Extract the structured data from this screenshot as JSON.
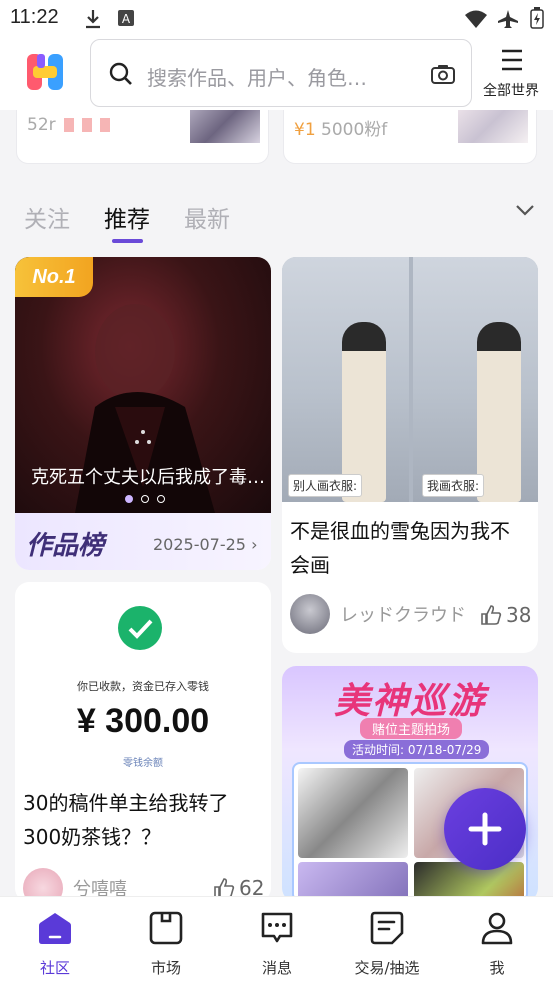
{
  "status_bar": {
    "time": "11:22"
  },
  "header": {
    "search_placeholder": "搜索作品、用户、角色…",
    "menu_label": "全部世界"
  },
  "top_cards": [
    {
      "meta": "52r"
    },
    {
      "price": "¥1",
      "meta": "5000粉f"
    }
  ],
  "tabs": [
    {
      "label": "关注",
      "active": false
    },
    {
      "label": "推荐",
      "active": true
    },
    {
      "label": "最新",
      "active": false
    }
  ],
  "feed": {
    "ranking": {
      "badge": "No.1",
      "caption": "克死五个丈夫以后我成了毒…",
      "title": "作品榜",
      "date": "2025-07-25",
      "carousel_dots": 3,
      "active_dot": 0
    },
    "post1": {
      "tag_left": "别人画衣服:",
      "tag_right": "我画衣服:",
      "title_line1": "不是很血的雪兔因为我不",
      "title_line2": "会画",
      "author": "レッドクラウド",
      "likes": "38"
    },
    "post2": {
      "receipt_line": "你已收款，资金已存入零钱",
      "amount": "¥ 300.00",
      "receipt_sub": "零钱余额",
      "title_line1": "30的稿件单主给我转了",
      "title_line2": "300奶茶钱？？",
      "author": "兮嘻嘻",
      "likes": "62"
    },
    "post3": {
      "event_title": "美神巡游",
      "event_sub": "赌位主题拍场",
      "event_time": "活动时间: 07/18-07/29"
    }
  },
  "fab": {
    "icon": "plus-icon"
  },
  "bottom_nav": [
    {
      "label": "社区",
      "icon": "home-icon",
      "active": true
    },
    {
      "label": "市场",
      "icon": "market-icon",
      "active": false
    },
    {
      "label": "消息",
      "icon": "message-icon",
      "active": false
    },
    {
      "label": "交易/抽选",
      "icon": "trade-icon",
      "active": false
    },
    {
      "label": "我",
      "icon": "profile-icon",
      "active": false
    }
  ],
  "colors": {
    "accent": "#5a3ad8",
    "badge": "#f2a420",
    "check": "#1bb36b"
  }
}
